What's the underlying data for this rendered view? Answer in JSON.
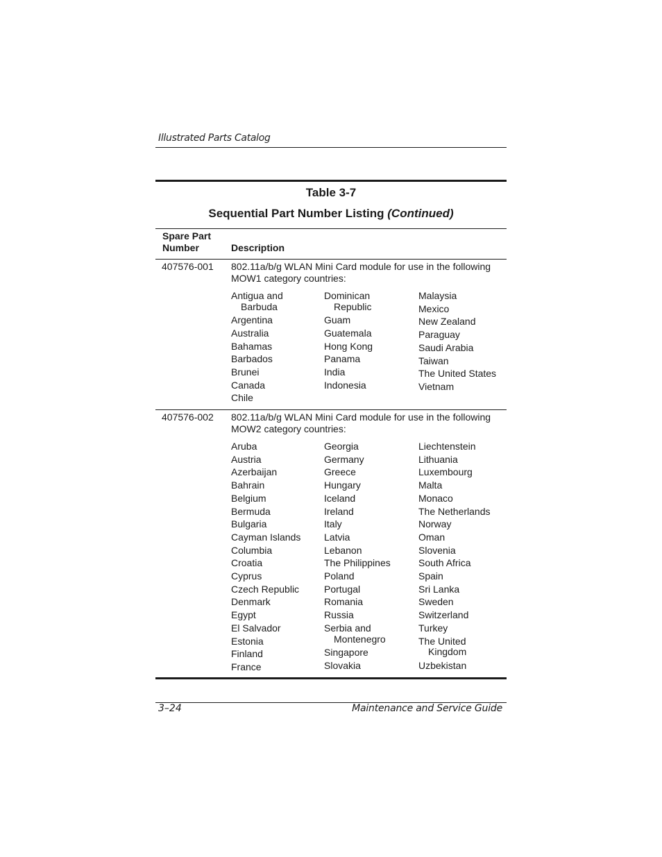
{
  "page": {
    "running_head": "Illustrated Parts Catalog",
    "footer_left": "3–24",
    "footer_right": "Maintenance and Service Guide"
  },
  "table": {
    "number": "Table 3-7",
    "title": "Sequential Part Number Listing",
    "title_suffix": "(Continued)",
    "headers": {
      "part_number_line1": "Spare Part",
      "part_number_line2": "Number",
      "description": "Description"
    },
    "rows": [
      {
        "part_number": "407576-001",
        "description_line1": "802.11a/b/g WLAN Mini Card module for use in the following",
        "description_line2": "MOW1 category countries:",
        "columns": [
          [
            {
              "name": "Antigua and",
              "cont": "Barbuda"
            },
            {
              "name": "Argentina"
            },
            {
              "name": "Australia"
            },
            {
              "name": "Bahamas"
            },
            {
              "name": "Barbados"
            },
            {
              "name": "Brunei"
            },
            {
              "name": "Canada"
            },
            {
              "name": "Chile"
            }
          ],
          [
            {
              "name": "Dominican",
              "cont": "Republic"
            },
            {
              "name": "Guam"
            },
            {
              "name": "Guatemala"
            },
            {
              "name": "Hong Kong"
            },
            {
              "name": "Panama"
            },
            {
              "name": "India"
            },
            {
              "name": "Indonesia"
            }
          ],
          [
            {
              "name": "Malaysia"
            },
            {
              "name": "Mexico"
            },
            {
              "name": "New Zealand"
            },
            {
              "name": "Paraguay"
            },
            {
              "name": "Saudi Arabia"
            },
            {
              "name": "Taiwan"
            },
            {
              "name": "The United States"
            },
            {
              "name": "Vietnam"
            }
          ]
        ]
      },
      {
        "part_number": "407576-002",
        "description_line1": "802.11a/b/g WLAN Mini Card module for use in the following",
        "description_line2": "MOW2 category countries:",
        "columns": [
          [
            {
              "name": "Aruba"
            },
            {
              "name": "Austria"
            },
            {
              "name": "Azerbaijan"
            },
            {
              "name": "Bahrain"
            },
            {
              "name": "Belgium"
            },
            {
              "name": "Bermuda"
            },
            {
              "name": "Bulgaria"
            },
            {
              "name": "Cayman Islands"
            },
            {
              "name": "Columbia"
            },
            {
              "name": "Croatia"
            },
            {
              "name": "Cyprus"
            },
            {
              "name": "Czech Republic"
            },
            {
              "name": "Denmark"
            },
            {
              "name": "Egypt"
            },
            {
              "name": "El Salvador"
            },
            {
              "name": "Estonia"
            },
            {
              "name": "Finland"
            },
            {
              "name": "France"
            }
          ],
          [
            {
              "name": "Georgia"
            },
            {
              "name": "Germany"
            },
            {
              "name": "Greece"
            },
            {
              "name": "Hungary"
            },
            {
              "name": "Iceland"
            },
            {
              "name": "Ireland"
            },
            {
              "name": "Italy"
            },
            {
              "name": "Latvia"
            },
            {
              "name": "Lebanon"
            },
            {
              "name": "The Philippines"
            },
            {
              "name": "Poland"
            },
            {
              "name": "Portugal"
            },
            {
              "name": "Romania"
            },
            {
              "name": "Russia"
            },
            {
              "name": "Serbia and",
              "cont": "Montenegro"
            },
            {
              "name": "Singapore"
            },
            {
              "name": "Slovakia"
            }
          ],
          [
            {
              "name": "Liechtenstein"
            },
            {
              "name": "Lithuania"
            },
            {
              "name": "Luxembourg"
            },
            {
              "name": "Malta"
            },
            {
              "name": "Monaco"
            },
            {
              "name": "The Netherlands"
            },
            {
              "name": "Norway"
            },
            {
              "name": "Oman"
            },
            {
              "name": "Slovenia"
            },
            {
              "name": "South Africa"
            },
            {
              "name": "Spain"
            },
            {
              "name": "Sri Lanka"
            },
            {
              "name": "Sweden"
            },
            {
              "name": "Switzerland"
            },
            {
              "name": "Turkey"
            },
            {
              "name": "The United",
              "cont": "Kingdom"
            },
            {
              "name": "Uzbekistan"
            }
          ]
        ]
      }
    ]
  }
}
